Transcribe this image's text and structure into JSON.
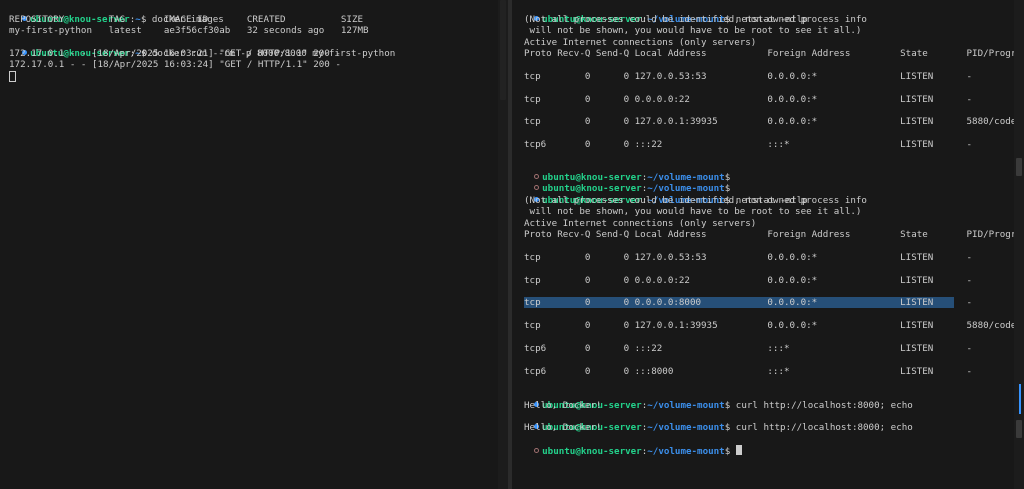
{
  "left": {
    "prompt_user": "ubuntu@knou-server",
    "prompt_path": "~",
    "cmd1": "docker images",
    "images_header": "REPOSITORY        TAG       IMAGE ID       CREATED          SIZE",
    "images_row": "my-first-python   latest    ae3f56cf30ab   32 seconds ago   127MB",
    "cmd2": "docker run --rm -p 8000:8000 my-first-python",
    "log1": "172.17.0.1 - - [18/Apr/2025 16:03:21] \"GET / HTTP/1.1\" 200 -",
    "log2": "172.17.0.1 - - [18/Apr/2025 16:03:24] \"GET / HTTP/1.1\" 200 -"
  },
  "right": {
    "prompt_user": "ubuntu@knou-server",
    "prompt_path": "~/volume-mount",
    "netstat_cmd": "netstat -ntlp",
    "warn1": "(Not all processes could be identified, non-owned process info",
    "warn2": " will not be shown, you would have to be root to see it all.)",
    "active": "Active Internet connections (only servers)",
    "header": "Proto Recv-Q Send-Q Local Address           Foreign Address         State       PID/Program name",
    "rows1": [
      "tcp        0      0 127.0.0.53:53           0.0.0.0:*               LISTEN      -",
      "tcp        0      0 0.0.0.0:22              0.0.0.0:*               LISTEN      -",
      "tcp        0      0 127.0.0.1:39935         0.0.0.0:*               LISTEN      5880/code-17baf8411",
      "tcp6       0      0 :::22                   :::*                    LISTEN      -"
    ],
    "rows2": [
      "tcp        0      0 127.0.0.53:53           0.0.0.0:*               LISTEN      -",
      "tcp        0      0 0.0.0.0:22              0.0.0.0:*               LISTEN      -",
      "tcp        0      0 0.0.0.0:8000            0.0.0.0:*               LISTEN      -",
      "tcp        0      0 127.0.0.1:39935         0.0.0.0:*               LISTEN      5880/code-17baf8411",
      "tcp6       0      0 :::22                   :::*                    LISTEN      -",
      "tcp6       0      0 :::8000                 :::*                    LISTEN      -"
    ],
    "curl_cmd": "curl http://localhost:8000; echo",
    "curl_out": "Hello, Docker!"
  }
}
